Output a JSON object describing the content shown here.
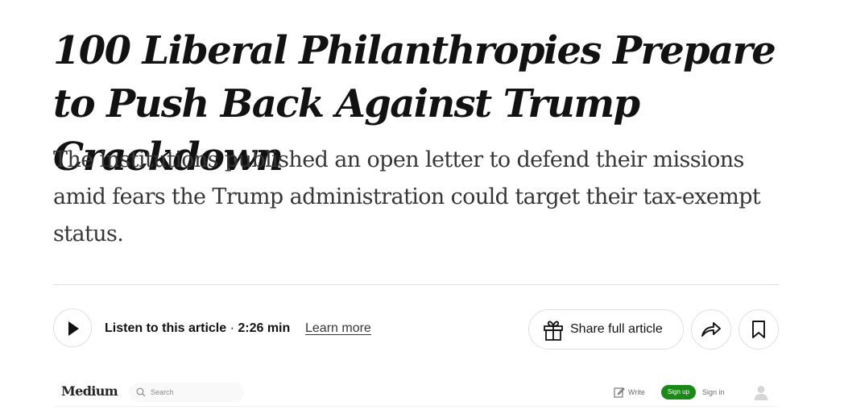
{
  "article": {
    "headline": "100 Liberal Philanthropies Prepare to Push Back Against Trump Crackdown",
    "summary": "The institutions published an open letter to defend their missions amid fears the Trump administration could target their tax-exempt status."
  },
  "audio": {
    "listen_label": "Listen to this article",
    "separator": " · ",
    "duration": "2:26 min",
    "learn_more": "Learn more",
    "play_icon": "play-icon"
  },
  "actions": {
    "share_label": "Share full article",
    "gift_icon": "gift-icon",
    "forward_icon": "share-arrow-icon",
    "bookmark_icon": "bookmark-icon"
  },
  "embed": {
    "logo": "Medium",
    "search_placeholder": "Search",
    "write_label": "Write",
    "signup_label": "Sign up",
    "signin_label": "Sign in",
    "accent_color": "#1a8917"
  }
}
